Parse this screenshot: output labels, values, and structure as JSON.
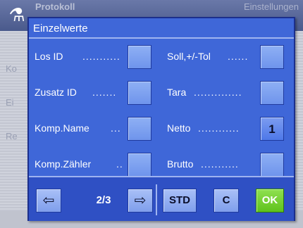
{
  "background": {
    "title": "Protokoll",
    "title_right": "Einstellungen",
    "side_items": [
      "Ko",
      "Ei",
      "Re"
    ]
  },
  "dialog": {
    "title": "Einzelwerte",
    "left_fields": [
      {
        "label": "Los ID",
        "dots": "...........",
        "value": ""
      },
      {
        "label": "Zusatz ID",
        "dots": ".......",
        "value": ""
      },
      {
        "label": "Komp.Name",
        "dots": "...",
        "value": ""
      },
      {
        "label": "Komp.Zähler",
        "dots": "..",
        "value": ""
      }
    ],
    "right_fields": [
      {
        "label": "Soll,+/-Tol",
        "dots": "......",
        "value": ""
      },
      {
        "label": "Tara",
        "dots": "..............",
        "value": ""
      },
      {
        "label": "Netto",
        "dots": "............",
        "value": "1"
      },
      {
        "label": "Brutto",
        "dots": "...........",
        "value": ""
      }
    ]
  },
  "footer": {
    "prev_icon": "⇦",
    "next_icon": "⇨",
    "page_indicator": "2/3",
    "std_label": "STD",
    "c_label": "C",
    "ok_label": "OK"
  },
  "colors": {
    "dialog_bg": "#3f67d8",
    "footer_bg": "#2f50c4",
    "ok_green": "#5fc21c"
  }
}
